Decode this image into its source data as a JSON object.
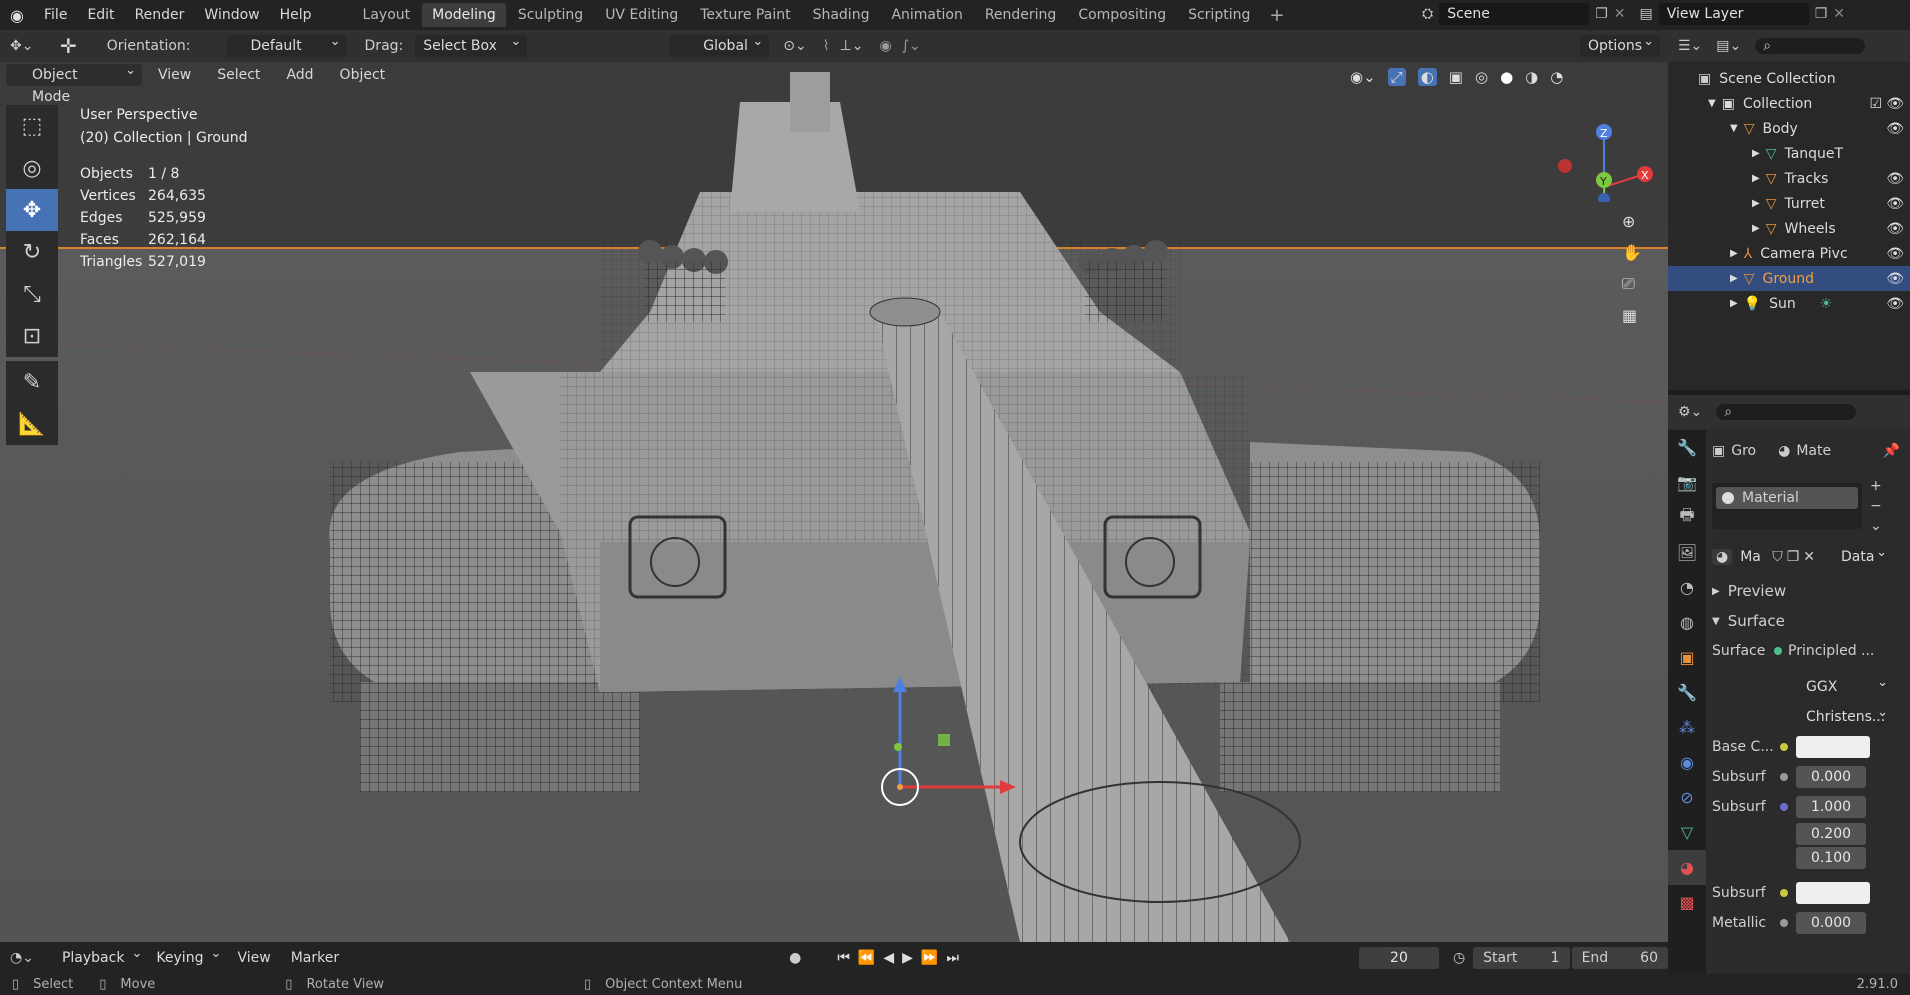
{
  "topbar": {
    "menus": [
      "File",
      "Edit",
      "Render",
      "Window",
      "Help"
    ],
    "workspaces": [
      "Layout",
      "Modeling",
      "Sculpting",
      "UV Editing",
      "Texture Paint",
      "Shading",
      "Animation",
      "Rendering",
      "Compositing",
      "Scripting"
    ],
    "active_workspace": "Modeling",
    "scene": "Scene",
    "view_layer": "View Layer"
  },
  "toolheader": {
    "orientation_label": "Orientation:",
    "orientation_value": "Default",
    "drag_label": "Drag:",
    "drag_value": "Select Box",
    "transform_orientation": "Global",
    "options": "Options"
  },
  "viewport_header": {
    "mode": "Object Mode",
    "menus": [
      "View",
      "Select",
      "Add",
      "Object"
    ]
  },
  "overlay": {
    "perspective": "User Perspective",
    "collection_info": "(20) Collection | Ground",
    "stats": [
      {
        "k": "Objects",
        "v": "1 / 8"
      },
      {
        "k": "Vertices",
        "v": "264,635"
      },
      {
        "k": "Edges",
        "v": "525,959"
      },
      {
        "k": "Faces",
        "v": "262,164"
      },
      {
        "k": "Triangles",
        "v": "527,019"
      }
    ]
  },
  "gizmo": {
    "x": "X",
    "y": "Y",
    "z": "Z"
  },
  "outliner": {
    "root": "Scene Collection",
    "items": [
      {
        "name": "Collection",
        "indent": 1
      },
      {
        "name": "Body",
        "indent": 2
      },
      {
        "name": "TanqueT",
        "indent": 3
      },
      {
        "name": "Tracks",
        "indent": 3
      },
      {
        "name": "Turret",
        "indent": 3
      },
      {
        "name": "Wheels",
        "indent": 3
      },
      {
        "name": "Camera Pivc",
        "indent": 2
      },
      {
        "name": "Ground",
        "indent": 2,
        "selected": true
      },
      {
        "name": "Sun",
        "indent": 2
      }
    ]
  },
  "properties": {
    "breadcrumb_obj": "Gro",
    "breadcrumb_mat": "Mate",
    "slot": "Material",
    "mat_name": "Ma",
    "link": "Data",
    "preview": "Preview",
    "surface_panel": "Surface",
    "surface_label": "Surface",
    "surface_value": "Principled ...",
    "distribution": "GGX",
    "subsurface_method": "Christens...",
    "rows": [
      {
        "label": "Base C...",
        "value": ""
      },
      {
        "label": "Subsurf",
        "value": "0.000"
      },
      {
        "label": "Subsurf",
        "value": "1.000"
      },
      {
        "label": "",
        "value": "0.200"
      },
      {
        "label": "",
        "value": "0.100"
      },
      {
        "label": "Subsurf",
        "value": ""
      },
      {
        "label": "Metallic",
        "value": "0.000"
      }
    ]
  },
  "timeline": {
    "menus": [
      "Playback",
      "Keying",
      "View",
      "Marker"
    ],
    "current_frame": "20",
    "start_label": "Start",
    "start": "1",
    "end_label": "End",
    "end": "60"
  },
  "statusbar": {
    "select": "Select",
    "move": "Move",
    "rotate": "Rotate View",
    "context": "Object Context Menu",
    "version": "2.91.0"
  }
}
